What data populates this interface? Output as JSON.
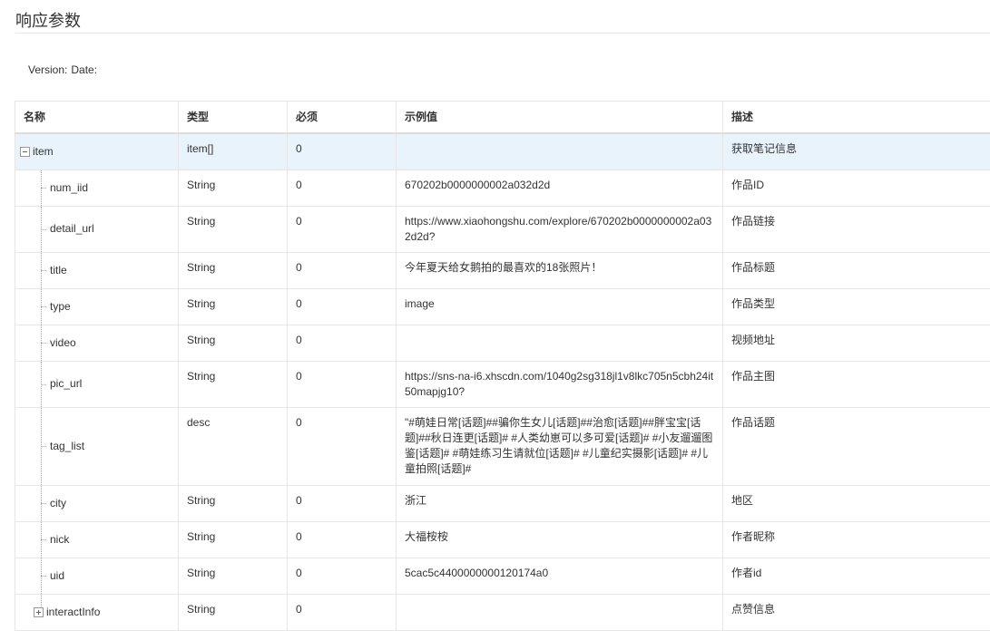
{
  "page": {
    "title": "响应参数"
  },
  "version": {
    "version_label": "Version:",
    "date_label": "Date:"
  },
  "table": {
    "headers": {
      "name": "名称",
      "type": "类型",
      "required": "必须",
      "example": "示例值",
      "description": "描述"
    },
    "parent": {
      "name": "item",
      "type": "item[]",
      "required": "0",
      "example": "",
      "description": "获取笔记信息"
    },
    "rows": [
      {
        "name": "num_iid",
        "type": "String",
        "required": "0",
        "example": "670202b0000000002a032d2d",
        "description": "作品ID"
      },
      {
        "name": "detail_url",
        "type": "String",
        "required": "0",
        "example": "https://www.xiaohongshu.com/explore/670202b0000000002a032d2d?",
        "description": "作品链接"
      },
      {
        "name": "title",
        "type": "String",
        "required": "0",
        "example": "今年夏天给女鹅拍的最喜欢的18张照片！",
        "description": "作品标题"
      },
      {
        "name": "type",
        "type": "String",
        "required": "0",
        "example": "image",
        "description": "作品类型"
      },
      {
        "name": "video",
        "type": "String",
        "required": "0",
        "example": "",
        "description": "视频地址"
      },
      {
        "name": "pic_url",
        "type": "String",
        "required": "0",
        "example": "https://sns-na-i6.xhscdn.com/1040g2sg318jl1v8lkc705n5cbh24it50mapjg10?",
        "description": "作品主图"
      },
      {
        "name": "tag_list",
        "type": "desc",
        "required": "0",
        "example": "\"#萌娃日常[话题]##骗你生女儿[话题]##治愈[话题]##胖宝宝[话题]##秋日连更[话题]# #人类幼崽可以多可爱[话题]# #小友遛遛图鉴[话题]# #萌娃练习生请就位[话题]# #儿童纪实摄影[话题]# #儿童拍照[话题]#",
        "description": "作品话题"
      },
      {
        "name": "city",
        "type": "String",
        "required": "0",
        "example": "浙江",
        "description": "地区"
      },
      {
        "name": "nick",
        "type": "String",
        "required": "0",
        "example": "大福桉桉",
        "description": "作者昵称"
      },
      {
        "name": "uid",
        "type": "String",
        "required": "0",
        "example": "5cac5c4400000000120174a0",
        "description": "作者id"
      }
    ],
    "collapsed": {
      "name": "interactInfo",
      "type": "String",
      "required": "0",
      "example": "",
      "description": "点赞信息"
    }
  }
}
